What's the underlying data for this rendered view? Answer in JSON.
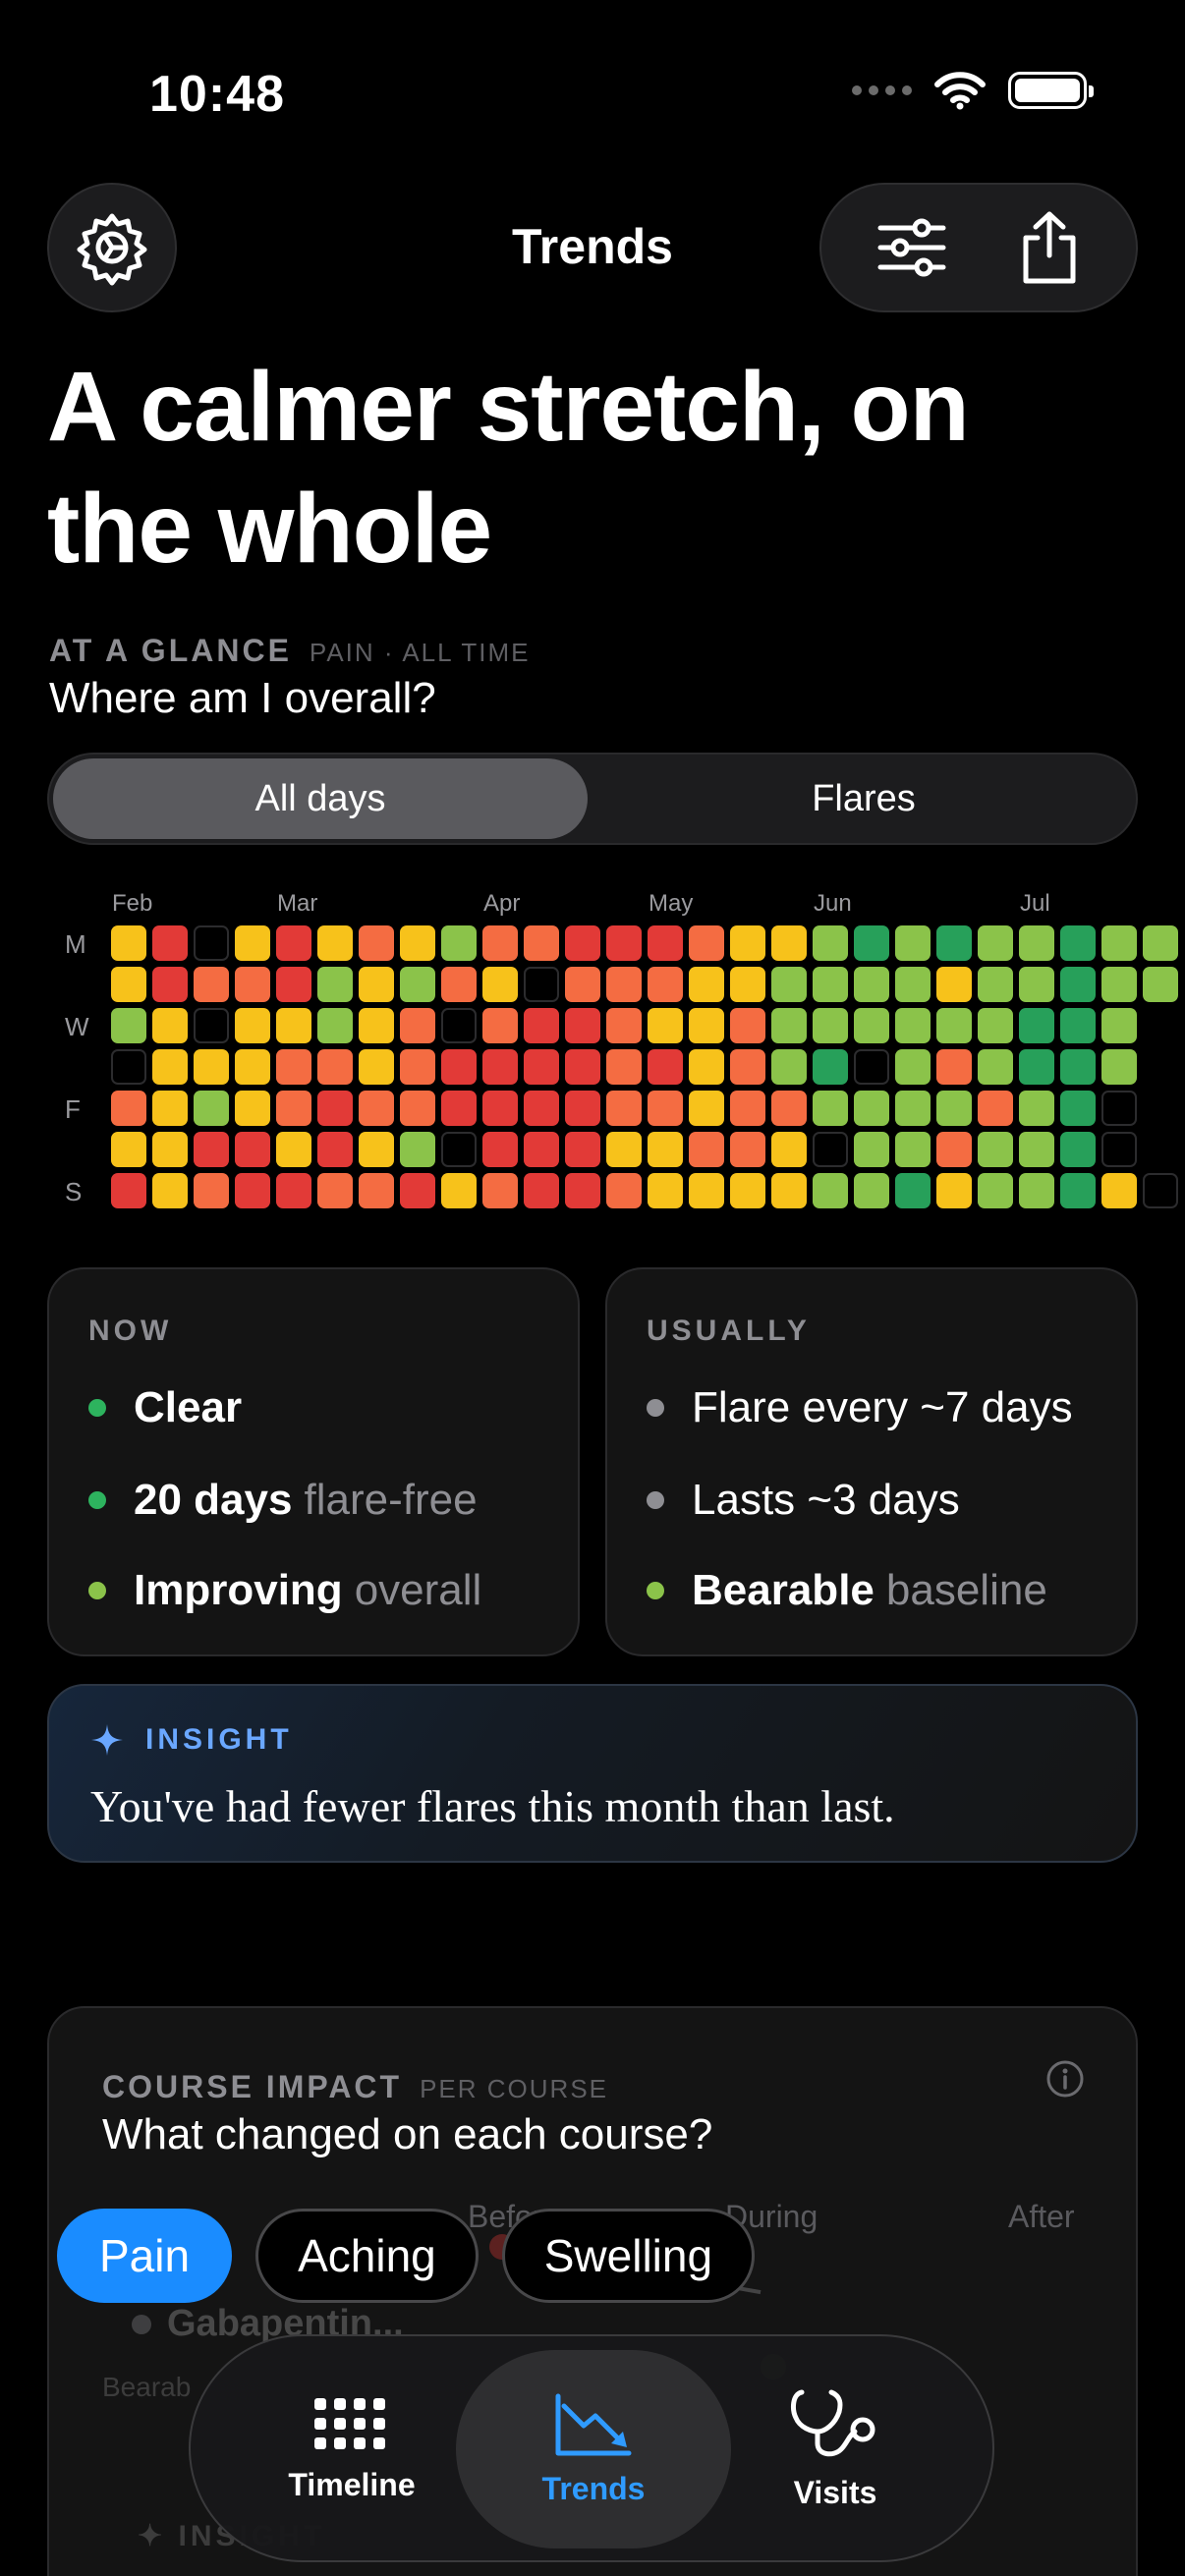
{
  "status": {
    "time": "10:48"
  },
  "nav": {
    "title": "Trends"
  },
  "headline": "A calmer stretch, on the whole",
  "glance": {
    "label": "AT A GLANCE",
    "sub": "PAIN · ALL TIME",
    "question": "Where am I overall?"
  },
  "segment": {
    "options": [
      "All days",
      "Flares"
    ],
    "selected": "All days"
  },
  "heatmap": {
    "months": [
      "Feb",
      "Mar",
      "Apr",
      "May",
      "Jun",
      "Jul"
    ],
    "day_labels": [
      "M",
      "W",
      "F",
      "S"
    ],
    "rows": [
      "YRXYRYOYGOORRROYYGDGDGGDGG",
      "YROORGYGOYXOOOYYGGGGYGGDGG",
      "GYXYYGYOXORROYYOGGGGGGDDG",
      "XYYYOOYORRRRORYOGDXGOGDDG",
      "OYGYOROORRRROOYOOGGGGOGDX",
      "YYRRYRYGXRRRYYOOYXGGOGGDX",
      "RYORROORYORROYYYYGGDYGGDYX"
    ],
    "legend": {
      "Y": "#f7c21b",
      "O": "#f46c42",
      "R": "#e23a37",
      "G": "#8bc34a",
      "D": "#27a05a",
      "X": "#000000"
    }
  },
  "now": {
    "label": "NOW",
    "rows": [
      {
        "strong": "Clear",
        "muted": "",
        "dot": "#2db35e"
      },
      {
        "strong": "20 days",
        "muted": "flare-free",
        "dot": "#2db35e"
      },
      {
        "strong": "Improving",
        "muted": "overall",
        "dot": "#8bc34a"
      }
    ]
  },
  "usually": {
    "label": "USUALLY",
    "rows": [
      {
        "plain": "Flare every ~7 days",
        "dot": "#8e8e93"
      },
      {
        "plain": "Lasts ~3 days",
        "dot": "#8e8e93"
      },
      {
        "strong": "Bearable",
        "muted": "baseline",
        "dot": "#8bc34a"
      }
    ]
  },
  "insight": {
    "label": "INSIGHT",
    "text": "You've had fewer flares this month than last."
  },
  "course": {
    "label": "COURSE IMPACT",
    "sub": "PER COURSE",
    "question": "What changed on each course?",
    "columns": [
      "Before",
      "During",
      "After"
    ],
    "med_name": "Gabapentin...",
    "baseline": "Bearab",
    "insight_label": "INSIGHT"
  },
  "chips": [
    "Pain",
    "Aching",
    "Swelling"
  ],
  "tabs": [
    {
      "label": "Timeline"
    },
    {
      "label": "Trends"
    },
    {
      "label": "Visits"
    }
  ],
  "active_tab": "Trends",
  "accent": "#2f9bff"
}
